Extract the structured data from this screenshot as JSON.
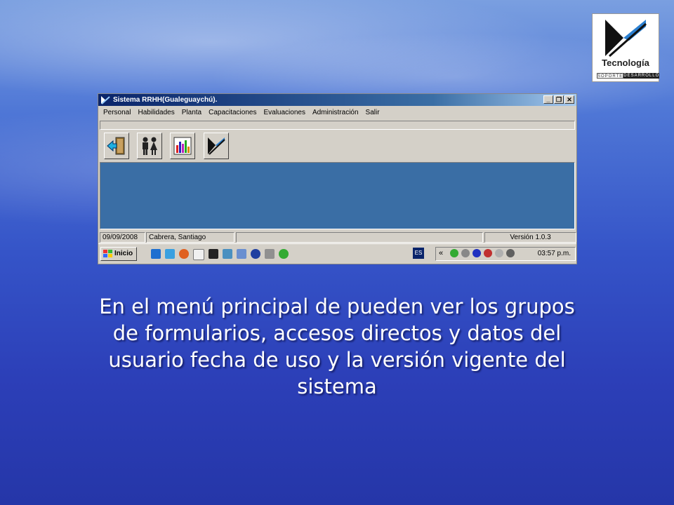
{
  "logo": {
    "name": "Tecnología",
    "strip_left": "SOPORTE",
    "strip_right": "DESARROLLO"
  },
  "window": {
    "title": "Sistema RRHH(Gualeguaychú).",
    "controls": {
      "minimize": "_",
      "restore": "❐",
      "close": "✕"
    },
    "menu": [
      "Personal",
      "Habilidades",
      "Planta",
      "Capacitaciones",
      "Evaluaciones",
      "Administración",
      "Salir"
    ],
    "toolbar": [
      {
        "icon": "exit-door-icon"
      },
      {
        "icon": "people-icon"
      },
      {
        "icon": "bar-chart-icon"
      },
      {
        "icon": "company-logo-icon"
      }
    ],
    "status": {
      "date": "09/09/2008",
      "user": "Cabrera, Santiago",
      "middle": "",
      "version": "Versión 1.0.3"
    }
  },
  "taskbar": {
    "start_label": "Inicio",
    "language": "ES",
    "tray_chevron": "«",
    "clock": "03:57 p.m."
  },
  "colors": {
    "client_area": "#3a6ea5",
    "titlebar": "#0a246a",
    "chrome": "#d4d0c8"
  },
  "caption": "En el menú principal de pueden ver los grupos de formularios, accesos directos y datos del usuario fecha de uso y la versión vigente del sistema"
}
